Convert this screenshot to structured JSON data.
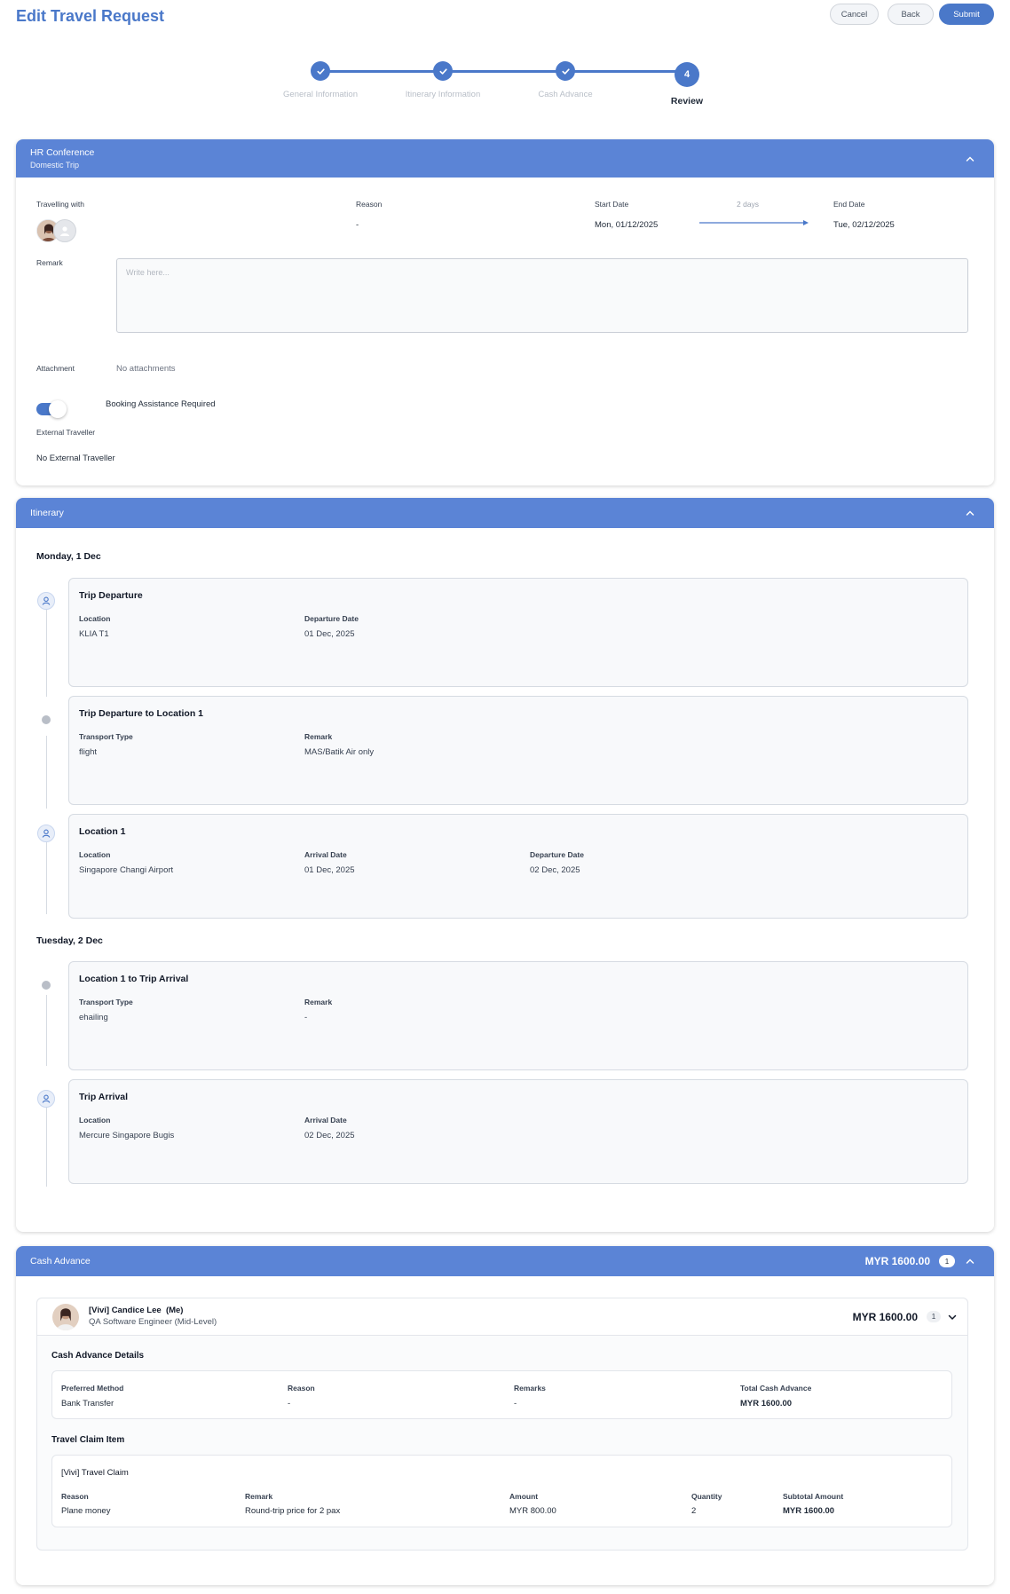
{
  "header": {
    "title": "Edit Travel Request",
    "cancel_label": "Cancel",
    "back_label": "Back",
    "submit_label": "Submit"
  },
  "stepper": {
    "steps": [
      {
        "label": "General Information",
        "status": "done"
      },
      {
        "label": "Itinerary Information",
        "status": "done"
      },
      {
        "label": "Cash Advance",
        "status": "done"
      },
      {
        "label": "Review",
        "status": "current",
        "number": "4"
      }
    ]
  },
  "trip": {
    "title": "HR Conference",
    "subtitle": "Domestic Trip",
    "travelling_with_label": "Travelling with",
    "reason_label": "Reason",
    "reason_value": "-",
    "start_date_label": "Start Date",
    "start_date_value": "Mon, 01/12/2025",
    "duration": "2 days",
    "end_date_label": "End Date",
    "end_date_value": "Tue, 02/12/2025",
    "remark_label": "Remark",
    "remark_placeholder": "Write here...",
    "attachment_label": "Attachment",
    "attachment_value": "No attachments",
    "booking_label": "Booking Assistance Required",
    "booking_enabled": true,
    "external_label": "External Traveller",
    "external_value": "No External Traveller"
  },
  "itinerary": {
    "title": "Itinerary",
    "days": [
      {
        "title": "Monday, 1 Dec",
        "items": [
          {
            "title": "Trip Departure",
            "icon": "person-pin-icon",
            "fields": [
              {
                "label": "Location",
                "value": "KLIA T1"
              },
              {
                "label": "Departure Date",
                "value": "01 Dec, 2025"
              }
            ]
          },
          {
            "title": "Trip Departure to Location 1",
            "icon": "dot",
            "fields": [
              {
                "label": "Transport Type",
                "value": "flight"
              },
              {
                "label": "Remark",
                "value": "MAS/Batik Air only"
              }
            ]
          },
          {
            "title": "Location 1",
            "icon": "person-pin-icon",
            "fields": [
              {
                "label": "Location",
                "value": "Singapore Changi Airport"
              },
              {
                "label": "Arrival Date",
                "value": "01 Dec, 2025"
              },
              {
                "label": "Departure Date",
                "value": "02 Dec, 2025"
              }
            ]
          }
        ]
      },
      {
        "title": "Tuesday, 2 Dec",
        "items": [
          {
            "title": "Location 1 to Trip Arrival",
            "icon": "dot",
            "fields": [
              {
                "label": "Transport Type",
                "value": "ehailing"
              },
              {
                "label": "Remark",
                "value": "-"
              }
            ]
          },
          {
            "title": "Trip Arrival",
            "icon": "person-pin-icon",
            "fields": [
              {
                "label": "Location",
                "value": "Mercure Singapore Bugis"
              },
              {
                "label": "Arrival Date",
                "value": "02 Dec, 2025"
              }
            ]
          }
        ]
      }
    ]
  },
  "cash_advance": {
    "title": "Cash Advance",
    "total": "MYR 1600.00",
    "count": "1",
    "person_name": "[Vivi] Candice Lee  (Me)",
    "person_role": "QA Software Engineer (Mid-Level)",
    "person_total": "MYR 1600.00",
    "person_count": "1",
    "details_title": "Cash Advance Details",
    "details": [
      {
        "label": "Preferred Method",
        "value": "Bank Transfer"
      },
      {
        "label": "Reason",
        "value": "-"
      },
      {
        "label": "Remarks",
        "value": "-"
      },
      {
        "label": "Total Cash Advance",
        "value": "MYR 1600.00"
      }
    ],
    "claim_title": "Travel Claim Item",
    "claim_name": "[Vivi] Travel Claim",
    "claim_fields": [
      {
        "label": "Reason",
        "value": "Plane money"
      },
      {
        "label": "Remark",
        "value": "Round-trip price for 2 pax"
      },
      {
        "label": "Amount",
        "value": "MYR 800.00"
      },
      {
        "label": "Quantity",
        "value": "2"
      },
      {
        "label": "Subtotal Amount",
        "value": "MYR 1600.00"
      }
    ]
  },
  "colors": {
    "accent": "#4a78c9",
    "header_bar": "#5b84d6"
  }
}
